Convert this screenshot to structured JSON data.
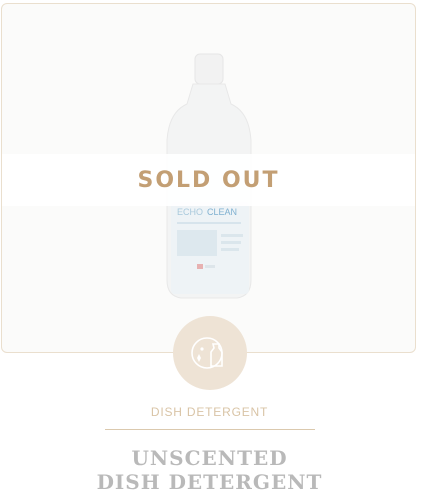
{
  "product": {
    "status_label": "SOLD OUT",
    "category": "DISH DETERGENT",
    "title_line1": "UNSCENTED",
    "title_line2": "DISH DETERGENT",
    "bottle_brand_prefix": "ECHO",
    "bottle_brand": "CLEAN"
  },
  "icons": {
    "category_icon": "dish-detergent-icon"
  },
  "colors": {
    "accent": "#c39f74",
    "badge_bg": "#eee3d5",
    "title": "#b9b9b9",
    "category": "#d9c4a6"
  }
}
